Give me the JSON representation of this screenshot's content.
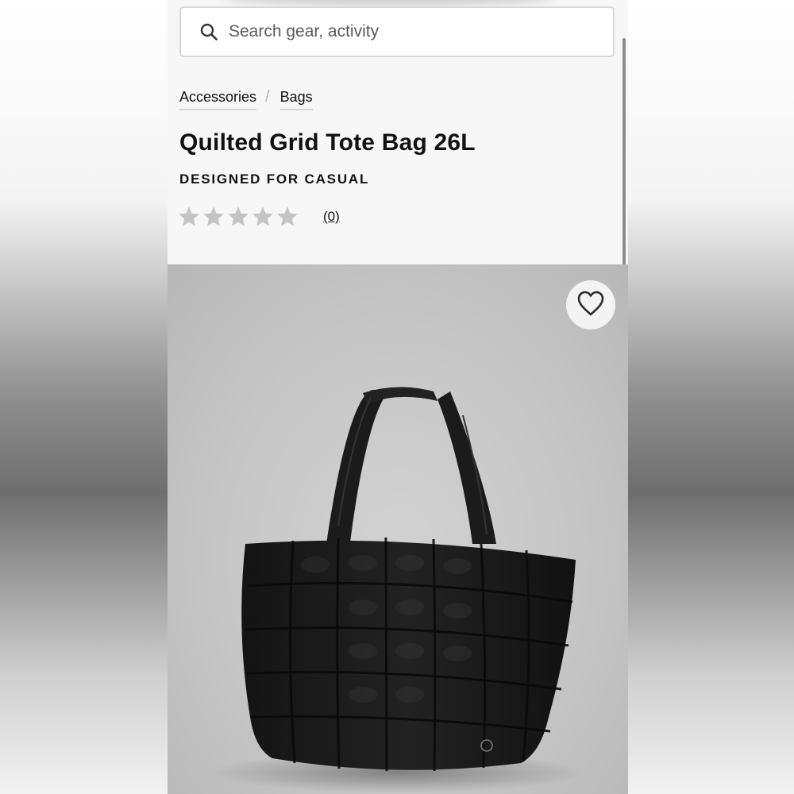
{
  "search": {
    "placeholder": "Search gear, activity",
    "icon": "search-icon"
  },
  "breadcrumb": [
    {
      "label": "Accessories"
    },
    {
      "label": "Bags"
    }
  ],
  "breadcrumb_separator": "/",
  "product": {
    "title": "Quilted Grid Tote Bag 26L",
    "subtitle": "DESIGNED FOR CASUAL",
    "rating": 0,
    "rating_max": 5,
    "review_count_label": "(0)"
  },
  "favorite": {
    "icon": "heart-icon"
  },
  "colors": {
    "star_empty": "#c4c4c4",
    "bag": "#1a1a1a",
    "photo_background": "#c8c8c8"
  }
}
